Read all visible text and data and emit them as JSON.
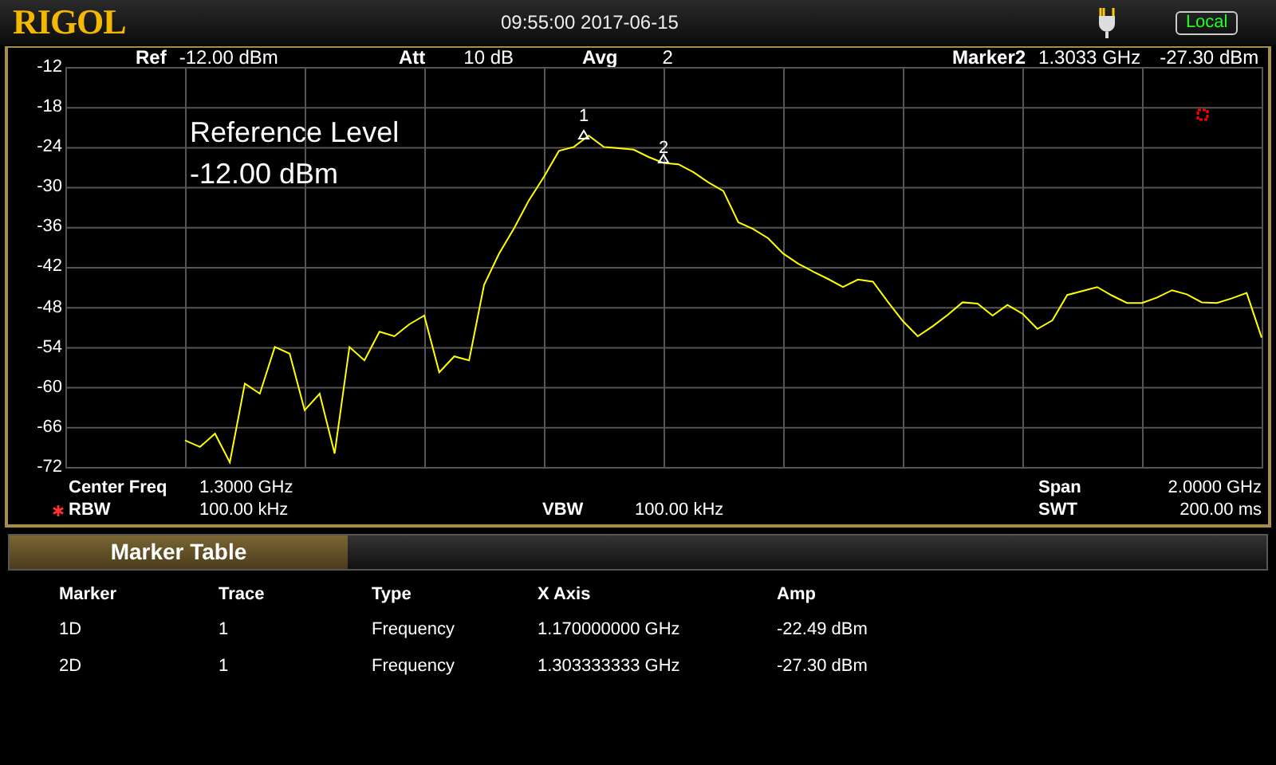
{
  "header": {
    "logo": "RIGOL",
    "datetime": "09:55:00 2017-06-15",
    "mode": "Local"
  },
  "top_info": [
    {
      "label": "Ref",
      "value": "-12.00 dBm"
    },
    {
      "label": "Att",
      "value": "10 dB"
    },
    {
      "label": "Avg",
      "value": "2"
    },
    {
      "label": "Marker2",
      "value": "1.3033 GHz",
      "extra": "-27.30 dBm"
    }
  ],
  "chart_data": {
    "type": "line",
    "grid": true,
    "ylim": [
      -72,
      -12
    ],
    "yticks": [
      -12,
      -18,
      -24,
      -30,
      -36,
      -42,
      -48,
      -54,
      -60,
      -66,
      -72
    ],
    "categories": [
      null,
      null,
      null,
      null,
      null,
      null,
      null,
      null,
      null,
      null,
      null,
      null,
      null,
      null,
      null,
      null,
      null,
      null,
      null,
      null,
      null,
      null,
      null,
      null,
      null,
      null,
      null,
      null,
      null,
      null,
      null,
      null,
      null,
      null,
      null,
      null,
      null,
      null,
      null,
      null,
      null,
      null,
      null,
      null,
      null,
      null,
      null,
      null,
      null,
      null,
      null,
      null,
      null,
      null,
      null,
      null,
      null,
      null,
      null,
      null,
      null,
      null,
      null,
      null,
      null,
      null,
      null,
      null,
      null,
      null,
      null,
      null,
      null,
      null,
      null,
      null,
      null,
      null,
      null,
      null,
      null
    ],
    "series": [
      {
        "color": "#ffff00",
        "values": [
          null,
          null,
          null,
          null,
          null,
          null,
          null,
          null,
          -68,
          -69,
          -67,
          -71.3,
          -59.5,
          -61,
          -54,
          -55,
          -63.5,
          -61,
          -70,
          -54,
          -56,
          -51.7,
          -52.4,
          -50.6,
          -49.3,
          -57.8,
          -55.4,
          -56,
          -44.7,
          -40,
          -36.2,
          -32,
          -28.5,
          -24.6,
          -24,
          -22.3,
          -24,
          -24.2,
          -24.4,
          -25.5,
          -26.4,
          -26.6,
          -27.8,
          -29.3,
          -30.6,
          -35.3,
          -36.3,
          -37.7,
          -40,
          -41.5,
          -42.7,
          -43.8,
          -45,
          -43.9,
          -44.2,
          -47.2,
          -50.1,
          -52.4,
          -50.9,
          -49.2,
          -47.3,
          -47.5,
          -49.3,
          -47.7,
          -49,
          -51.3,
          -50,
          -46.2,
          -45.6,
          -45,
          -46.3,
          -47.4,
          -47.4,
          -46.6,
          -45.5,
          -46.1,
          -47.3,
          -47.4,
          -46.7,
          -45.9,
          -52.6
        ]
      }
    ]
  },
  "overlay": [
    "Reference Level",
    "-12.00 dBm"
  ],
  "markers": [
    {
      "label": "1"
    },
    {
      "label": "2"
    }
  ],
  "bottom_info": [
    [
      {
        "label": "Center Freq",
        "value": "1.3000 GHz",
        "modified": false
      },
      {
        "label": "Span",
        "value": "2.0000 GHz",
        "modified": false
      }
    ],
    [
      {
        "label": "RBW",
        "value": "100.00 kHz",
        "modified": true
      },
      {
        "label": "VBW",
        "value": "100.00 kHz",
        "modified": false
      },
      {
        "label": "SWT",
        "value": "200.00 ms",
        "modified": false
      }
    ]
  ],
  "marker_table": {
    "tabs": [
      {
        "label": "Marker Table",
        "selected": true
      }
    ],
    "columns": [
      "Marker",
      "Trace",
      "Type",
      "X Axis",
      "Amp"
    ],
    "rows": [
      [
        "1D",
        "1",
        "Frequency",
        "1.170000000 GHz",
        "-22.49 dBm"
      ],
      [
        "2D",
        "1",
        "Frequency",
        "1.303333333 GHz",
        "-27.30 dBm"
      ]
    ]
  }
}
